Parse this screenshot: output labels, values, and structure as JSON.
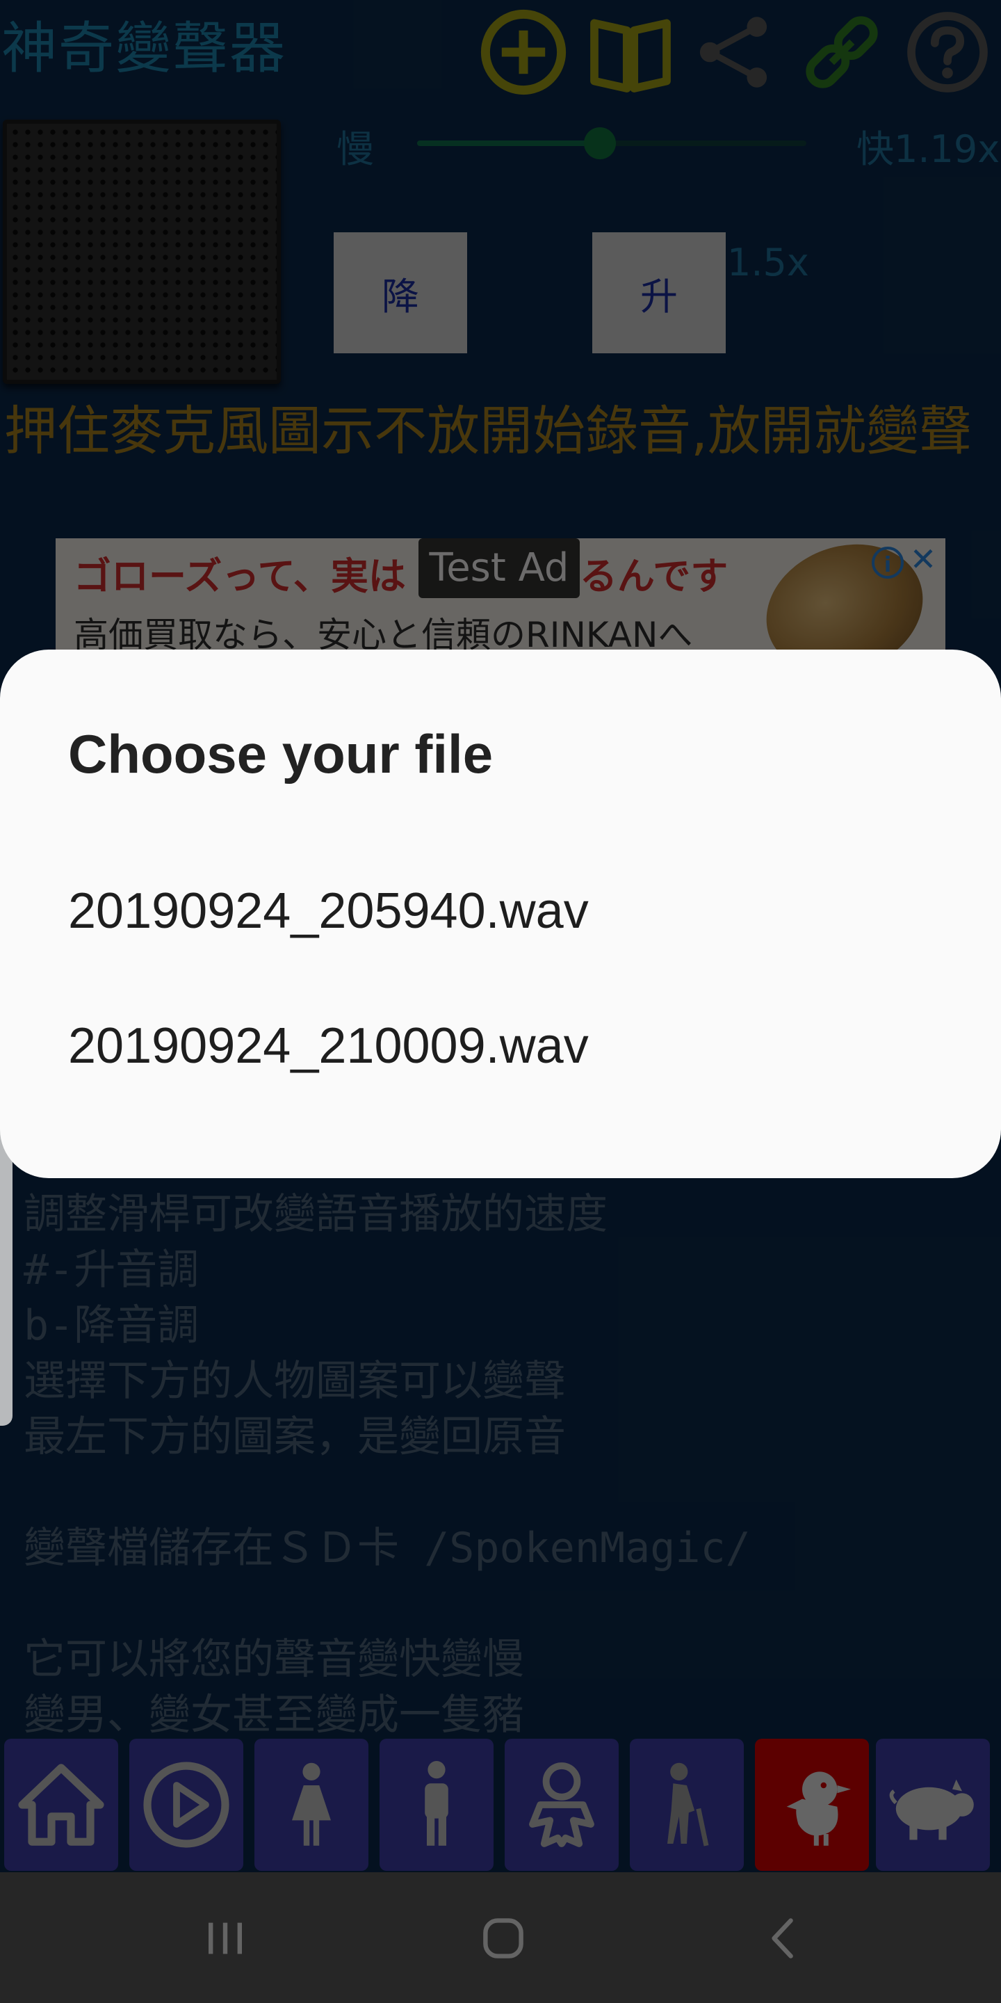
{
  "app": {
    "title": "神奇變聲器",
    "header_icons": [
      "add-circle-icon",
      "book-icon",
      "share-icon",
      "link-icon",
      "help-icon"
    ]
  },
  "speed": {
    "slow_label": "慢",
    "fast_label": "快1.19x",
    "slider_fraction": 0.47
  },
  "pitch": {
    "down_label": "降",
    "up_label": "升",
    "value": "1.5x"
  },
  "instruction": "押住麥克風圖示不放開始錄音,放開就變聲",
  "ad": {
    "badge": "Test Ad",
    "line1": "ゴローズって、実は",
    "line1_tail": "るんです",
    "line2": "高価買取なら、安心と信頼のRINKANへ"
  },
  "info_lines": [
    "調整滑桿可改變語音播放的速度",
    "#-升音調",
    "b-降音調",
    "選擇下方的人物圖案可以變聲",
    "最左下方的圖案，是變回原音",
    "",
    "變聲檔儲存在ＳＤ卡 /SpokenMagic/",
    "",
    "它可以將您的聲音變快變慢",
    "變男、變女甚至變成一隻豬"
  ],
  "dialog": {
    "title": "Choose your file",
    "files": [
      "20190924_205940.wav",
      "20190924_210009.wav"
    ]
  },
  "character_bar": {
    "buttons": [
      "home-icon",
      "play-icon",
      "woman-icon",
      "man-icon",
      "baby-icon",
      "elder-icon",
      "chick-icon",
      "pig-icon"
    ],
    "active": "chick-icon",
    "colors": {
      "button": "#3a3aa0",
      "active": "#cc0000"
    }
  },
  "system_nav": [
    "recents-icon",
    "home-circle-icon",
    "back-icon"
  ]
}
